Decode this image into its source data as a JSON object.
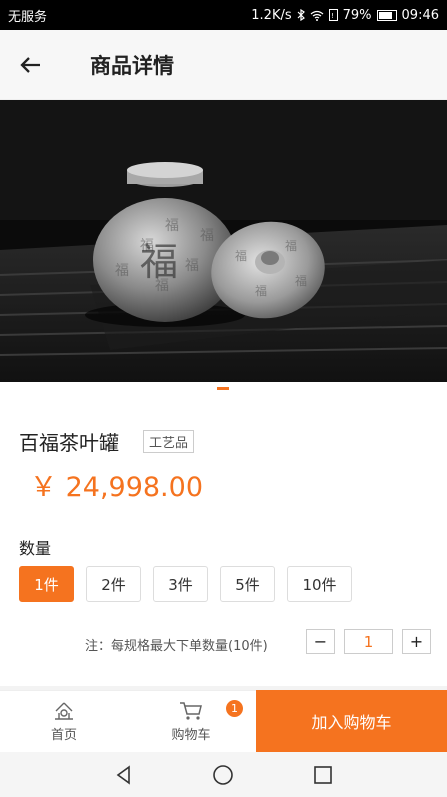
{
  "status_bar": {
    "carrier": "无服务",
    "network_speed": "1.2K/s",
    "battery": "79%",
    "time": "09:46"
  },
  "header": {
    "title": "商品详情",
    "back_icon": "arrow-left-icon"
  },
  "gallery": {
    "image_description_icon": "pewter-tea-caddy-image"
  },
  "product": {
    "name": "百福茶叶罐",
    "tag": "工艺品",
    "price": "￥ 24,998.00"
  },
  "quantity": {
    "label": "数量",
    "options": [
      "1件",
      "2件",
      "3件",
      "5件",
      "10件"
    ],
    "selected": "1件",
    "note": "注：每规格最大下单数量(10件)",
    "stepper_minus": "−",
    "stepper_value": "1",
    "stepper_plus": "+"
  },
  "bottom": {
    "home_label": "首页",
    "cart_label": "购物车",
    "cart_badge": "1",
    "add_to_cart": "加入购物车"
  },
  "colors": {
    "accent": "#f5731f"
  }
}
